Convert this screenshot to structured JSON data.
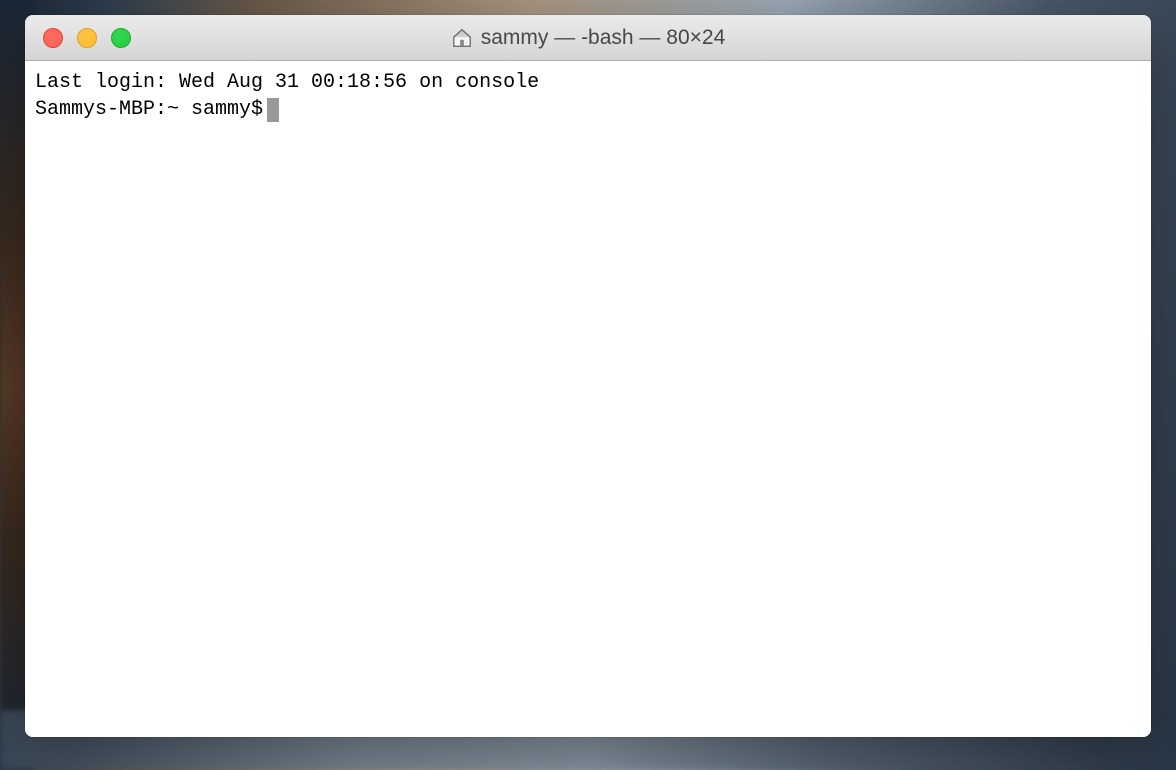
{
  "window": {
    "title": "sammy — -bash — 80×24"
  },
  "terminal": {
    "last_login_line": "Last login: Wed Aug 31 00:18:56 on console",
    "prompt": "Sammys-MBP:~ sammy$ "
  }
}
